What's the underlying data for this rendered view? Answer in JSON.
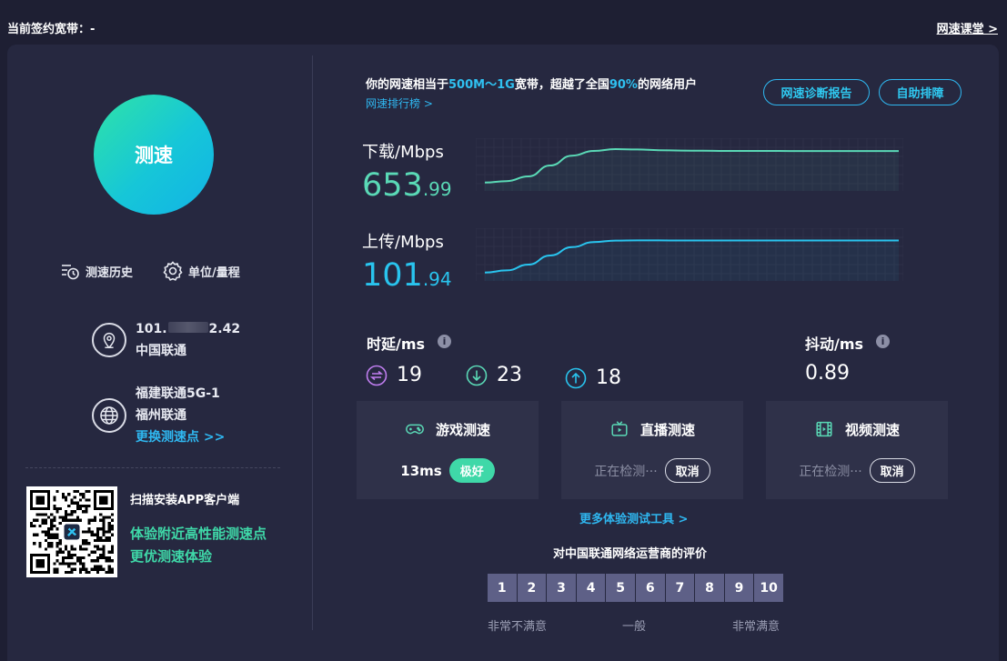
{
  "top": {
    "contract_bandwidth": "当前签约宽带：-",
    "class_link": "网速课堂 >"
  },
  "left": {
    "speed_button": "测速",
    "history": "测速历史",
    "units": "单位/量程",
    "ip_prefix": "101.",
    "ip_suffix": "2.42",
    "isp": "中国联通",
    "server_name": "福建联通5G-1",
    "server_city": "福州联通",
    "change_server": "更换测速点 >>",
    "qr_title": "扫描安装APP客户端",
    "qr_line1": "体验附近高性能测速点",
    "qr_line2": "更优测速体验"
  },
  "summary": {
    "prefix": "你的网速相当于",
    "tier": "500M～1G",
    "mid": "宽带，超越了全国",
    "percent": "90%",
    "suffix": "的网络用户",
    "rank_link": "网速排行榜 >"
  },
  "buttons": {
    "diagnosis": "网速诊断报告",
    "self_help": "自助排障"
  },
  "download": {
    "label": "下载/Mbps",
    "int": "653",
    "dec": ".99",
    "curve": [
      0.08,
      0.12,
      0.25,
      0.55,
      0.82,
      0.95,
      1.0,
      0.99,
      0.97,
      0.96,
      0.955,
      0.95,
      0.95,
      0.95,
      0.948,
      0.948,
      0.947,
      0.947,
      0.947,
      0.947
    ],
    "color": "#5ad9b6"
  },
  "upload": {
    "label": "上传/Mbps",
    "int": "101",
    "dec": ".94",
    "curve": [
      0.08,
      0.14,
      0.3,
      0.55,
      0.78,
      0.92,
      0.96,
      0.965,
      0.965,
      0.963,
      0.962,
      0.962,
      0.962,
      0.962,
      0.962,
      0.962,
      0.962,
      0.962,
      0.962,
      0.962
    ],
    "color": "#29c4ee"
  },
  "latency": {
    "label": "时延/ms",
    "exchange": "19",
    "down": "23",
    "up": "18"
  },
  "jitter": {
    "label": "抖动/ms",
    "value": "0.89"
  },
  "cards": {
    "game": {
      "title": "游戏测速",
      "result": "13ms",
      "badge": "极好"
    },
    "live": {
      "title": "直播测速",
      "status": "正在检测···",
      "cancel": "取消"
    },
    "video": {
      "title": "视频测速",
      "status": "正在检测···",
      "cancel": "取消"
    }
  },
  "more_tools": "更多体验测试工具 >",
  "rating": {
    "title": "对中国联通网络运营商的评价",
    "scores": [
      "1",
      "2",
      "3",
      "4",
      "5",
      "6",
      "7",
      "8",
      "9",
      "10"
    ],
    "low": "非常不满意",
    "mid": "一般",
    "high": "非常满意"
  },
  "colors": {
    "accent": "#2fb7f0",
    "good": "#3fd8a8",
    "background": "#1e1f33",
    "panel": "#262840"
  }
}
